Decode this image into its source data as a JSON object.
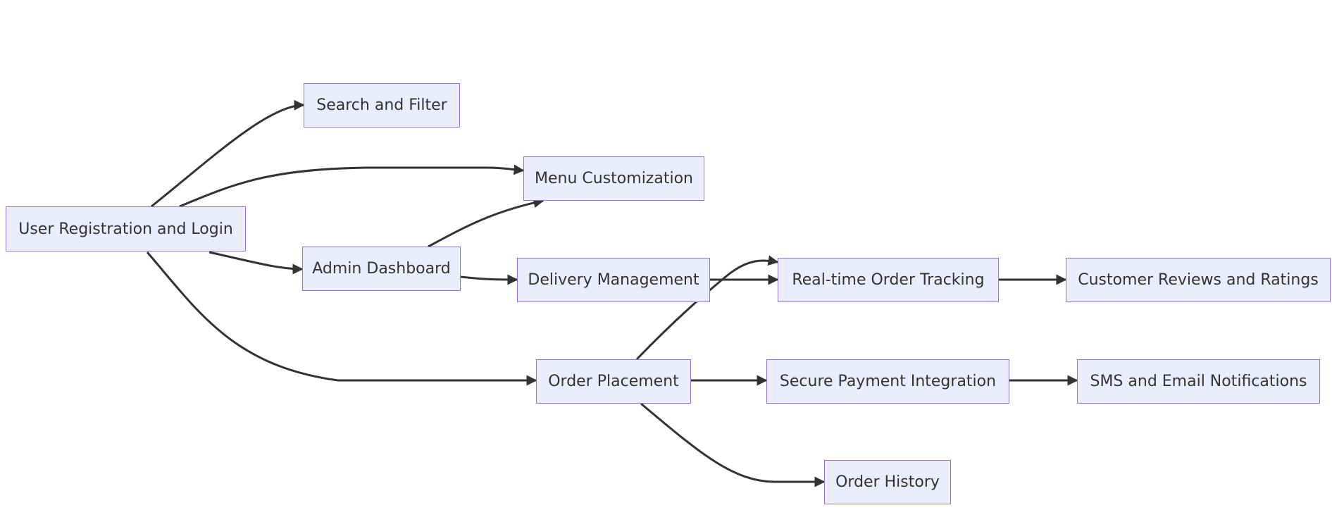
{
  "diagram": {
    "type": "flowchart",
    "direction": "LR",
    "colors": {
      "node_fill": "#ECECFF",
      "node_border": "#9370DB",
      "text": "#333333",
      "edge": "#333333",
      "background": "#ffffff"
    },
    "nodes": [
      {
        "id": "A",
        "label": "User Registration and Login"
      },
      {
        "id": "B",
        "label": "Search and Filter"
      },
      {
        "id": "C",
        "label": "Menu Customization"
      },
      {
        "id": "D",
        "label": "Admin Dashboard"
      },
      {
        "id": "E",
        "label": "Delivery Management"
      },
      {
        "id": "F",
        "label": "Real-time Order Tracking"
      },
      {
        "id": "G",
        "label": "Customer Reviews and Ratings"
      },
      {
        "id": "H",
        "label": "Order Placement"
      },
      {
        "id": "I",
        "label": "Secure Payment Integration"
      },
      {
        "id": "J",
        "label": "SMS and Email Notifications"
      },
      {
        "id": "K",
        "label": "Order History"
      }
    ],
    "edges": [
      {
        "from": "A",
        "to": "B"
      },
      {
        "from": "A",
        "to": "C"
      },
      {
        "from": "A",
        "to": "D"
      },
      {
        "from": "A",
        "to": "H"
      },
      {
        "from": "D",
        "to": "C"
      },
      {
        "from": "D",
        "to": "E"
      },
      {
        "from": "E",
        "to": "F"
      },
      {
        "from": "H",
        "to": "F"
      },
      {
        "from": "F",
        "to": "G"
      },
      {
        "from": "H",
        "to": "I"
      },
      {
        "from": "I",
        "to": "J"
      },
      {
        "from": "H",
        "to": "K"
      }
    ]
  }
}
